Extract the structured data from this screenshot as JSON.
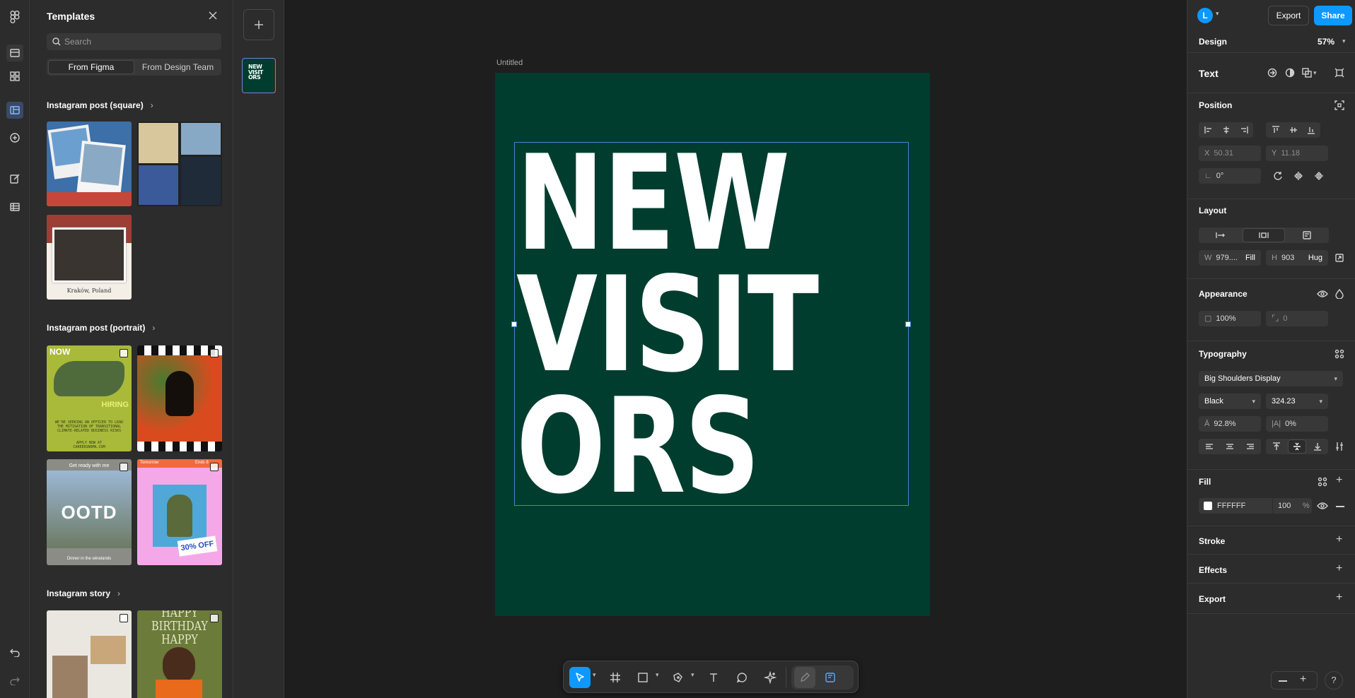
{
  "templates": {
    "title": "Templates",
    "search_placeholder": "Search",
    "tab_from_figma": "From Figma",
    "tab_from_design_team": "From Design Team",
    "sections": [
      {
        "title": "Instagram post (square)"
      },
      {
        "title": "Instagram post (portrait)"
      },
      {
        "title": "Instagram story"
      }
    ],
    "thumb_texts": {
      "krakow": "Kraków, Poland",
      "now": "NOW",
      "hiring": "HIRING",
      "hiring_body": "WE'RE SEEKING AN OFFICER TO LEAD THE MITIGATION OF TRANSITIONAL CLIMATE-RELATED BUSINESS RISKS",
      "apply": "APPLY NOW AT CAREERSNOMA.COM",
      "get_ready": "Get ready with me",
      "ootd": "OOTD",
      "dinner": "Dinner in the winelands",
      "tomorrow": "Tomorrow",
      "ends": "Ends 8",
      "off": "30% OFF",
      "birthday_1": "HAPPY",
      "birthday_2": "BIRTHDAY",
      "birthday_3": "HAPPY"
    }
  },
  "pages": {
    "thumb_text": "NEW VISIT ORS"
  },
  "canvas": {
    "frame_name": "Untitled",
    "text_content": "NEW\nVISIT\nORS",
    "frame_color": "#003d2e"
  },
  "header": {
    "avatar_letter": "L",
    "export_label": "Export",
    "share_label": "Share",
    "tab_design": "Design",
    "zoom": "57%"
  },
  "props": {
    "layer_type": "Text",
    "position": {
      "title": "Position",
      "x_label": "X",
      "x": "50.31",
      "y_label": "Y",
      "y": "11.18",
      "rotation": "0°"
    },
    "layout": {
      "title": "Layout",
      "w_label": "W",
      "w": "979....",
      "w_mode": "Fill",
      "h_label": "H",
      "h": "903",
      "h_mode": "Hug"
    },
    "appearance": {
      "title": "Appearance",
      "opacity": "100%",
      "radius": "0"
    },
    "typography": {
      "title": "Typography",
      "font": "Big Shoulders Display",
      "weight": "Black",
      "size": "324.23",
      "line_height": "92.8%",
      "letter_spacing": "0%"
    },
    "fill": {
      "title": "Fill",
      "hex": "FFFFFF",
      "opacity": "100",
      "unit": "%"
    },
    "stroke": "Stroke",
    "effects": "Effects",
    "export": "Export"
  },
  "colors": {
    "accent": "#0d99ff",
    "selection": "#3b86d6"
  }
}
